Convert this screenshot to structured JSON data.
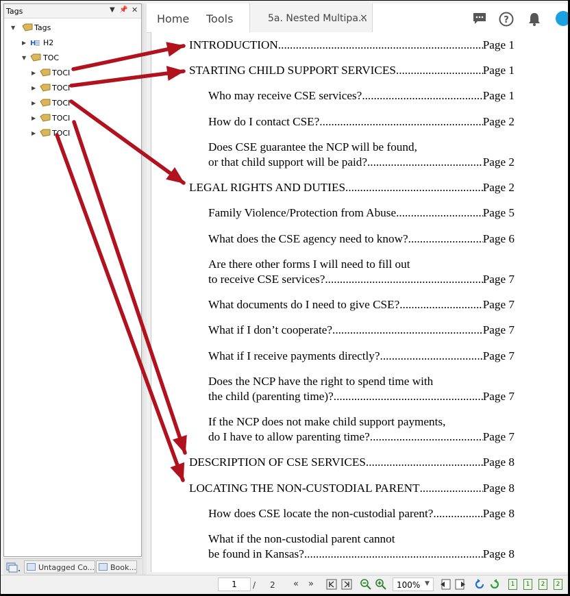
{
  "tags_panel": {
    "title": "Tags",
    "tree": [
      {
        "label": "Tags",
        "expander": "▼",
        "icon": "tag-icon"
      },
      {
        "label": "H2",
        "expander": "▶",
        "icon": "heading-element-icon"
      },
      {
        "label": "TOC",
        "expander": "▼",
        "icon": "tag-icon"
      },
      {
        "label": "TOCI",
        "expander": "▶",
        "icon": "tag-icon"
      },
      {
        "label": "TOCI",
        "expander": "▶",
        "icon": "tag-icon"
      },
      {
        "label": "TOCI",
        "expander": "▶",
        "icon": "tag-icon"
      },
      {
        "label": "TOCI",
        "expander": "▶",
        "icon": "tag-icon"
      },
      {
        "label": "TOCI",
        "expander": "▶",
        "icon": "tag-icon"
      }
    ],
    "bottom_tabs": [
      "Untagged Co...",
      "Book..."
    ]
  },
  "topnav": {
    "home": "Home",
    "tools": "Tools",
    "doc_tab": "5a. Nested Multipa...",
    "close": "×"
  },
  "toc": [
    {
      "text": "INTRODUCTION ",
      "page": "Page 1"
    },
    {
      "text": "STARTING CHILD SUPPORT SERVICES ",
      "page": "Page 1"
    },
    {
      "text": "Who may receive CSE services? ",
      "page": "Page 1"
    },
    {
      "text": "How do I contact CSE?",
      "page": "Page 2"
    },
    {
      "text1": "Does CSE guarantee the NCP will be found,",
      "text": "or that child support will be paid?",
      "page": "Page 2"
    },
    {
      "text": "LEGAL RIGHTS AND DUTIES ",
      "page": "Page 2"
    },
    {
      "text": "Family Violence/Protection from Abuse",
      "page": "Page 5"
    },
    {
      "text": "What does the CSE agency need to know?",
      "page": "Page 6"
    },
    {
      "text1": "Are there other forms I will need to fill out",
      "text": "to receive CSE services?",
      "page": "Page 7"
    },
    {
      "text": "What documents do I need to give CSE?",
      "page": "Page 7"
    },
    {
      "text": "What if I don’t cooperate? ",
      "page": "Page 7"
    },
    {
      "text": "What if I receive payments directly? ",
      "page": "Page 7"
    },
    {
      "text1": "Does the NCP have the right to spend time with",
      "text": "the child (parenting time)? ",
      "page": "Page 7"
    },
    {
      "text1": "If the NCP does not make child support payments,",
      "text": "do I have to allow parenting time?",
      "page": "Page 7"
    },
    {
      "text": "DESCRIPTION OF CSE SERVICES",
      "page": "Page 8"
    },
    {
      "text": "LOCATING THE NON-CUSTODIAL PARENT ",
      "page": "Page 8"
    },
    {
      "text": "How does CSE locate the non-custodial parent? ",
      "page": "Page 8"
    },
    {
      "text1": "What if the non-custodial parent cannot",
      "text": "be found in Kansas? ",
      "page": "Page 8"
    }
  ],
  "statusbar": {
    "current_page": "1",
    "separator": "/",
    "total_pages": "2",
    "zoom": "100%"
  },
  "colors": {
    "arrow": "#b0121e",
    "accent": "#1ba1e2",
    "tag_icon": "#d9b75a"
  }
}
